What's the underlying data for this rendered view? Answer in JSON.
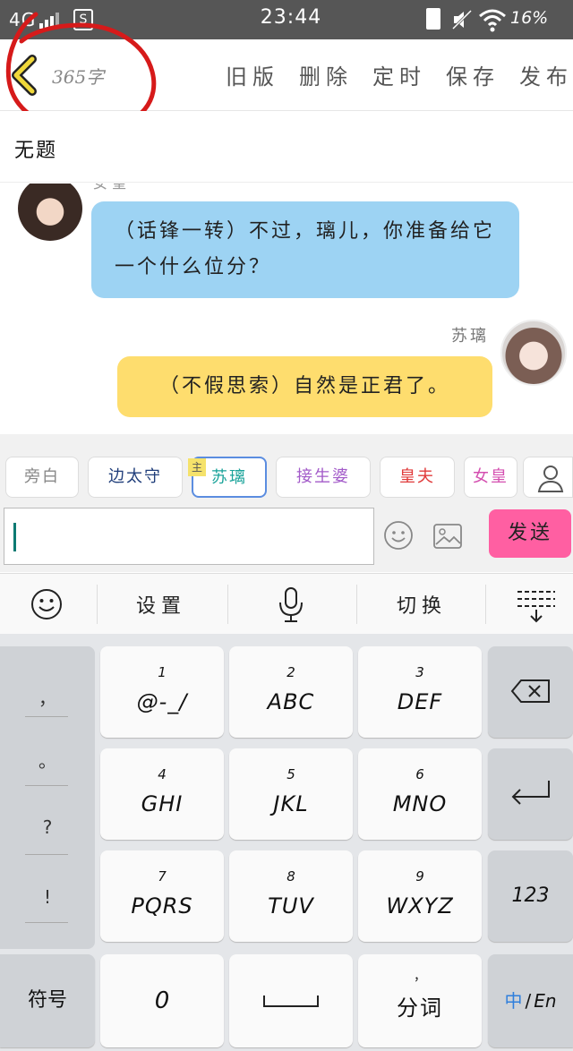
{
  "status_bar": {
    "network": "4G",
    "sim_badge": "S",
    "time": "23:44",
    "battery_pct": "16%"
  },
  "header": {
    "word_count": "365字",
    "actions": [
      "旧版",
      "删除",
      "定时",
      "保存",
      "发布"
    ]
  },
  "document": {
    "title": "无题"
  },
  "chat": {
    "speaker_top_fragment": "女 皇",
    "blue_message": "（话锋一转）不过，璃儿，你准备给它一个什么位分？",
    "right_speaker": "苏璃",
    "yellow_message": "（不假思索）自然是正君了。"
  },
  "roles": {
    "items": [
      "旁白",
      "边太守",
      "苏璃",
      "接生婆",
      "皇夫",
      "女皇"
    ],
    "main_badge": "主",
    "colors": [
      "#888888",
      "#1f3d7a",
      "#1aa39a",
      "#a35bc9",
      "#e03a3a",
      "#d44fb0"
    ],
    "selected": "苏璃"
  },
  "composer": {
    "input_value": "",
    "send_label": "发送"
  },
  "ime_bar": {
    "settings_label": "设置",
    "switch_label": "切换"
  },
  "keyboard": {
    "punctuation": [
      "，",
      "。",
      "?",
      "!"
    ],
    "keys": [
      {
        "num": "1",
        "letters": "@-_/"
      },
      {
        "num": "2",
        "letters": "ABC"
      },
      {
        "num": "3",
        "letters": "DEF"
      },
      {
        "num": "4",
        "letters": "GHI"
      },
      {
        "num": "5",
        "letters": "JKL"
      },
      {
        "num": "6",
        "letters": "MNO"
      },
      {
        "num": "7",
        "letters": "PQRS"
      },
      {
        "num": "8",
        "letters": "TUV"
      },
      {
        "num": "9",
        "letters": "WXYZ"
      }
    ],
    "numbers_key": "123",
    "symbols_key": "符号",
    "zero_key": "0",
    "segment_key": "分词",
    "segment_mark": "，",
    "lang_zh": "中",
    "lang_sep": "/",
    "lang_en": "En"
  }
}
